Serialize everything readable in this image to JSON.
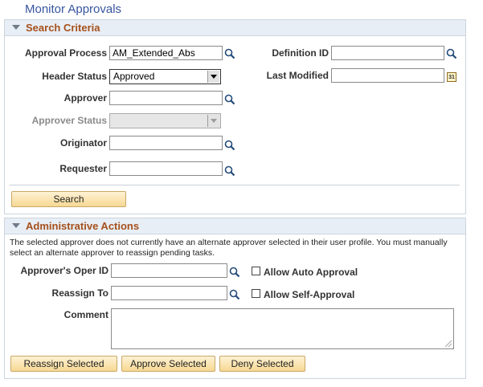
{
  "page_title": "Monitor Approvals",
  "search_criteria": {
    "title": "Search Criteria",
    "approval_process_label": "Approval Process",
    "approval_process_value": "AM_Extended_Abs",
    "definition_id_label": "Definition ID",
    "definition_id_value": "",
    "header_status_label": "Header Status",
    "header_status_value": "Approved",
    "last_modified_label": "Last Modified",
    "last_modified_value": "",
    "calendar_icon_text": "31",
    "approver_label": "Approver",
    "approver_value": "",
    "approver_status_label": "Approver Status",
    "approver_status_value": "",
    "originator_label": "Originator",
    "originator_value": "",
    "requester_label": "Requester",
    "requester_value": "",
    "search_button": "Search"
  },
  "admin_actions": {
    "title": "Administrative Actions",
    "message": "The selected approver does not currently have an alternate approver selected in their user profile.  You must manually select an alternate approver to reassign pending tasks.",
    "opr_id_label": "Approver's Oper ID",
    "opr_id_value": "",
    "allow_auto_label": "Allow Auto Approval",
    "reassign_to_label": "Reassign To",
    "reassign_to_value": "",
    "allow_self_label": "Allow Self-Approval",
    "comment_label": "Comment",
    "comment_value": "",
    "reassign_button": "Reassign Selected",
    "approve_button": "Approve Selected",
    "deny_button": "Deny Selected"
  },
  "colors": {
    "title_link": "#37559f",
    "section_title": "#a5501c",
    "section_header_bg": "#e8eef5",
    "button_bg": "#f6d893"
  }
}
